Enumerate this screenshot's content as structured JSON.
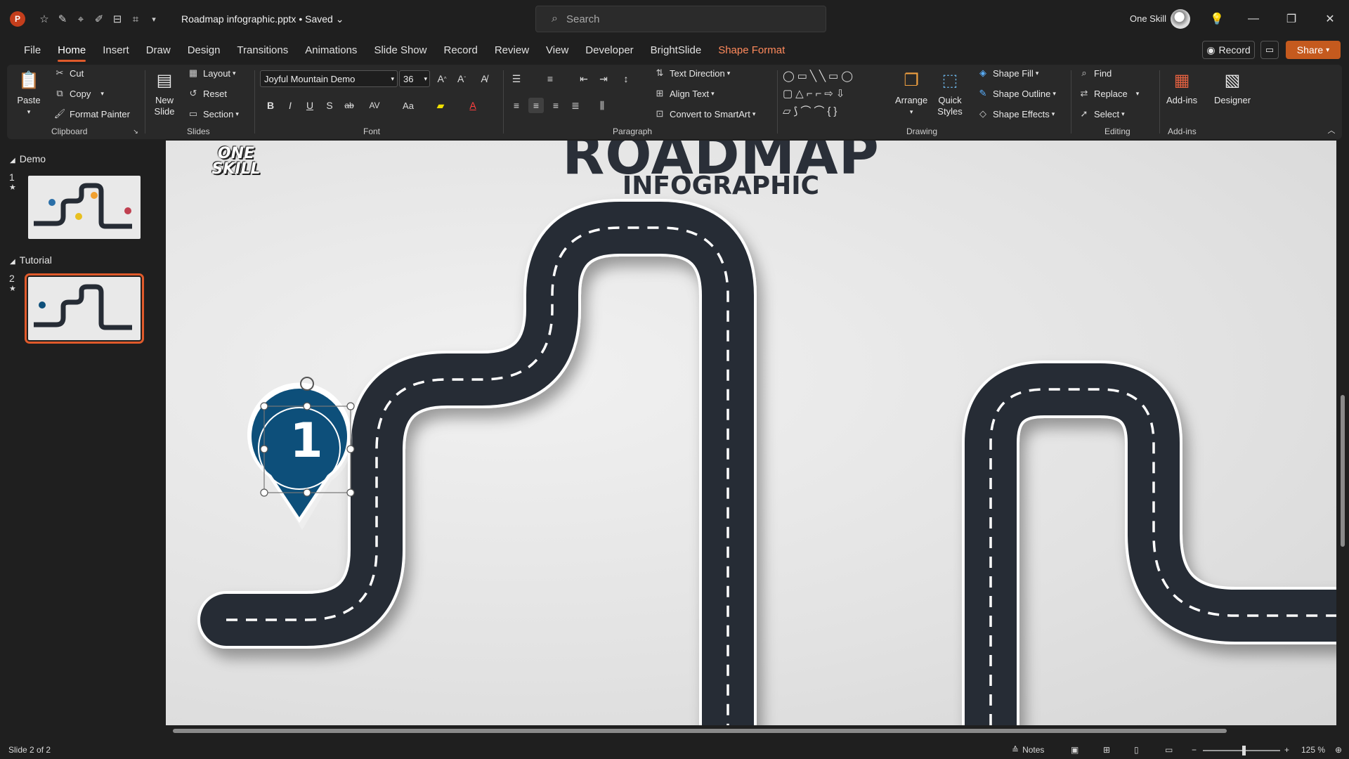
{
  "app": {
    "logo": "P",
    "doc_title": "Roadmap infographic.pptx • Saved ⌄",
    "search_placeholder": "Search",
    "user_name": "One Skill",
    "window": {
      "minimize": "—",
      "restore": "❐",
      "close": "✕"
    }
  },
  "quick_access": {
    "icons": [
      "star-icon",
      "pen-icon",
      "crosshair-icon",
      "brush-icon",
      "align-icon",
      "crop-icon",
      "chevron-down-icon"
    ]
  },
  "tabs": [
    "File",
    "Home",
    "Insert",
    "Draw",
    "Design",
    "Transitions",
    "Animations",
    "Slide Show",
    "Record",
    "Review",
    "View",
    "Developer",
    "BrightSlide",
    "Shape Format"
  ],
  "active_tab": "Home",
  "tab_right": {
    "record": "Record",
    "share": "Share"
  },
  "ribbon": {
    "clipboard": {
      "paste": "Paste",
      "cut": "Cut",
      "copy": "Copy",
      "format_painter": "Format Painter",
      "label": "Clipboard"
    },
    "slides": {
      "new_slide": "New Slide",
      "layout": "Layout",
      "reset": "Reset",
      "section": "Section",
      "label": "Slides"
    },
    "font": {
      "name": "Joyful Mountain Demo",
      "size": "36",
      "label": "Font",
      "bold": "B",
      "italic": "I",
      "underline": "U",
      "shadow": "S",
      "strike": "ab",
      "spacing": "AV",
      "case": "Aa"
    },
    "paragraph": {
      "text_direction": "Text Direction",
      "align_text": "Align Text",
      "smartart": "Convert to SmartArt",
      "label": "Paragraph"
    },
    "drawing": {
      "arrange": "Arrange",
      "quick_styles": "Quick Styles",
      "shape_fill": "Shape Fill",
      "shape_outline": "Shape Outline",
      "shape_effects": "Shape Effects",
      "label": "Drawing"
    },
    "editing": {
      "find": "Find",
      "replace": "Replace",
      "select": "Select",
      "label": "Editing"
    },
    "addins": {
      "addins": "Add-ins",
      "designer": "Designer",
      "label": "Add-ins"
    }
  },
  "slide_panel": {
    "sections": [
      {
        "name": "Demo",
        "slides": [
          {
            "number": "1",
            "marker": "★"
          }
        ]
      },
      {
        "name": "Tutorial",
        "slides": [
          {
            "number": "2",
            "marker": "★"
          }
        ]
      }
    ]
  },
  "slide": {
    "logo_line1": "ONE",
    "logo_line2": "SKILL",
    "title": "ROADMAP",
    "subtitle": "INFOGRAPHIC",
    "marker_number": "1",
    "marker_color": "#0d4f7a",
    "road_color": "#262c35"
  },
  "status": {
    "slide_info": "Slide 2 of 2",
    "notes": "Notes",
    "zoom": "125 %"
  }
}
